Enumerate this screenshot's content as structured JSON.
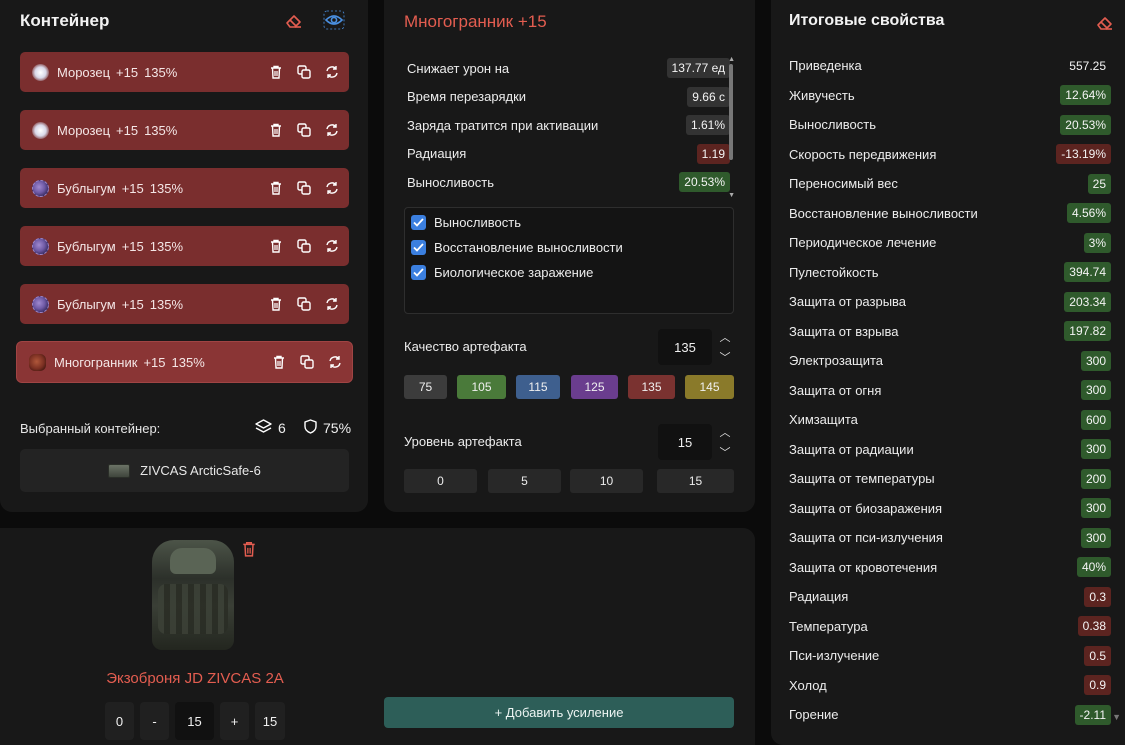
{
  "container_panel": {
    "title": "Контейнер",
    "artifacts": [
      {
        "name": "Морозец",
        "level": "+15",
        "quality": "135%",
        "icon": "frost-artifact-icon"
      },
      {
        "name": "Морозец",
        "level": "+15",
        "quality": "135%",
        "icon": "frost-artifact-icon"
      },
      {
        "name": "Бублыгум",
        "level": "+15",
        "quality": "135%",
        "icon": "bubblegum-artifact-icon"
      },
      {
        "name": "Бублыгум",
        "level": "+15",
        "quality": "135%",
        "icon": "bubblegum-artifact-icon"
      },
      {
        "name": "Бублыгум",
        "level": "+15",
        "quality": "135%",
        "icon": "bubblegum-artifact-icon"
      },
      {
        "name": "Многогранник",
        "level": "+15",
        "quality": "135%",
        "icon": "polyhedron-artifact-icon"
      }
    ],
    "selected_label": "Выбранный контейнер:",
    "slots_count": "6",
    "protection": "75%",
    "container_name": "ZIVCAS ArcticSafe-6"
  },
  "artifact_panel": {
    "title": "Многогранник +15",
    "properties": [
      {
        "label": "Снижает урон на",
        "value": "137.77 ед",
        "tone": "neutral"
      },
      {
        "label": "Время перезарядки",
        "value": "9.66 с",
        "tone": "neutral"
      },
      {
        "label": "Заряда тратится при активации",
        "value": "1.61%",
        "tone": "neutral"
      },
      {
        "label": "Радиация",
        "value": "1.19",
        "tone": "red"
      },
      {
        "label": "Выносливость",
        "value": "20.53%",
        "tone": "green"
      }
    ],
    "checkboxes": [
      {
        "label": "Выносливость",
        "checked": true
      },
      {
        "label": "Восстановление выносливости",
        "checked": true
      },
      {
        "label": "Биологическое заражение",
        "checked": true
      }
    ],
    "quality_label": "Качество артефакта",
    "quality_value": "135",
    "quality_presets": [
      {
        "label": "75",
        "color": "#3c3c3c"
      },
      {
        "label": "105",
        "color": "#4a7a3a"
      },
      {
        "label": "115",
        "color": "#3e5f8e"
      },
      {
        "label": "125",
        "color": "#6a3d8e"
      },
      {
        "label": "135",
        "color": "#7a3230"
      },
      {
        "label": "145",
        "color": "#8a7a2a"
      }
    ],
    "level_label": "Уровень артефакта",
    "level_value": "15",
    "level_presets": [
      "0",
      "5",
      "10",
      "15"
    ]
  },
  "totals_panel": {
    "title": "Итоговые свойства",
    "rows": [
      {
        "label": "Приведенка",
        "value": "557.25",
        "tone": "none"
      },
      {
        "label": "Живучесть",
        "value": "12.64%",
        "tone": "green"
      },
      {
        "label": "Выносливость",
        "value": "20.53%",
        "tone": "green"
      },
      {
        "label": "Скорость передвижения",
        "value": "-13.19%",
        "tone": "red"
      },
      {
        "label": "Переносимый вес",
        "value": "25",
        "tone": "green"
      },
      {
        "label": "Восстановление выносливости",
        "value": "4.56%",
        "tone": "green"
      },
      {
        "label": "Периодическое лечение",
        "value": "3%",
        "tone": "green"
      },
      {
        "label": "Пулестойкость",
        "value": "394.74",
        "tone": "green"
      },
      {
        "label": "Защита от разрыва",
        "value": "203.34",
        "tone": "green"
      },
      {
        "label": "Защита от взрыва",
        "value": "197.82",
        "tone": "green"
      },
      {
        "label": "Электрозащита",
        "value": "300",
        "tone": "green"
      },
      {
        "label": "Защита от огня",
        "value": "300",
        "tone": "green"
      },
      {
        "label": "Химзащита",
        "value": "600",
        "tone": "green"
      },
      {
        "label": "Защита от радиации",
        "value": "300",
        "tone": "green"
      },
      {
        "label": "Защита от температуры",
        "value": "200",
        "tone": "green"
      },
      {
        "label": "Защита от биозаражения",
        "value": "300",
        "tone": "green"
      },
      {
        "label": "Защита от пси-излучения",
        "value": "300",
        "tone": "green"
      },
      {
        "label": "Защита от кровотечения",
        "value": "40%",
        "tone": "green"
      },
      {
        "label": "Радиация",
        "value": "0.3",
        "tone": "red"
      },
      {
        "label": "Температура",
        "value": "0.38",
        "tone": "red"
      },
      {
        "label": "Пси-излучение",
        "value": "0.5",
        "tone": "red"
      },
      {
        "label": "Холод",
        "value": "0.9",
        "tone": "red"
      },
      {
        "label": "Горение",
        "value": "-2.11",
        "tone": "green"
      }
    ]
  },
  "armor_panel": {
    "name": "Экзоброня JD ZIVCAS 2A",
    "level_min": "0",
    "decrement": "-",
    "level_value": "15",
    "increment": "+",
    "level_max": "15",
    "add_button": "+ Добавить усиление"
  },
  "colors": {
    "accent_red": "#e35d50",
    "artifact_row": "#7a2e2e",
    "positive": "#2f5a2c",
    "negative": "#5c2420",
    "checkbox": "#3b7fdf",
    "add_button": "#2d5e58"
  }
}
